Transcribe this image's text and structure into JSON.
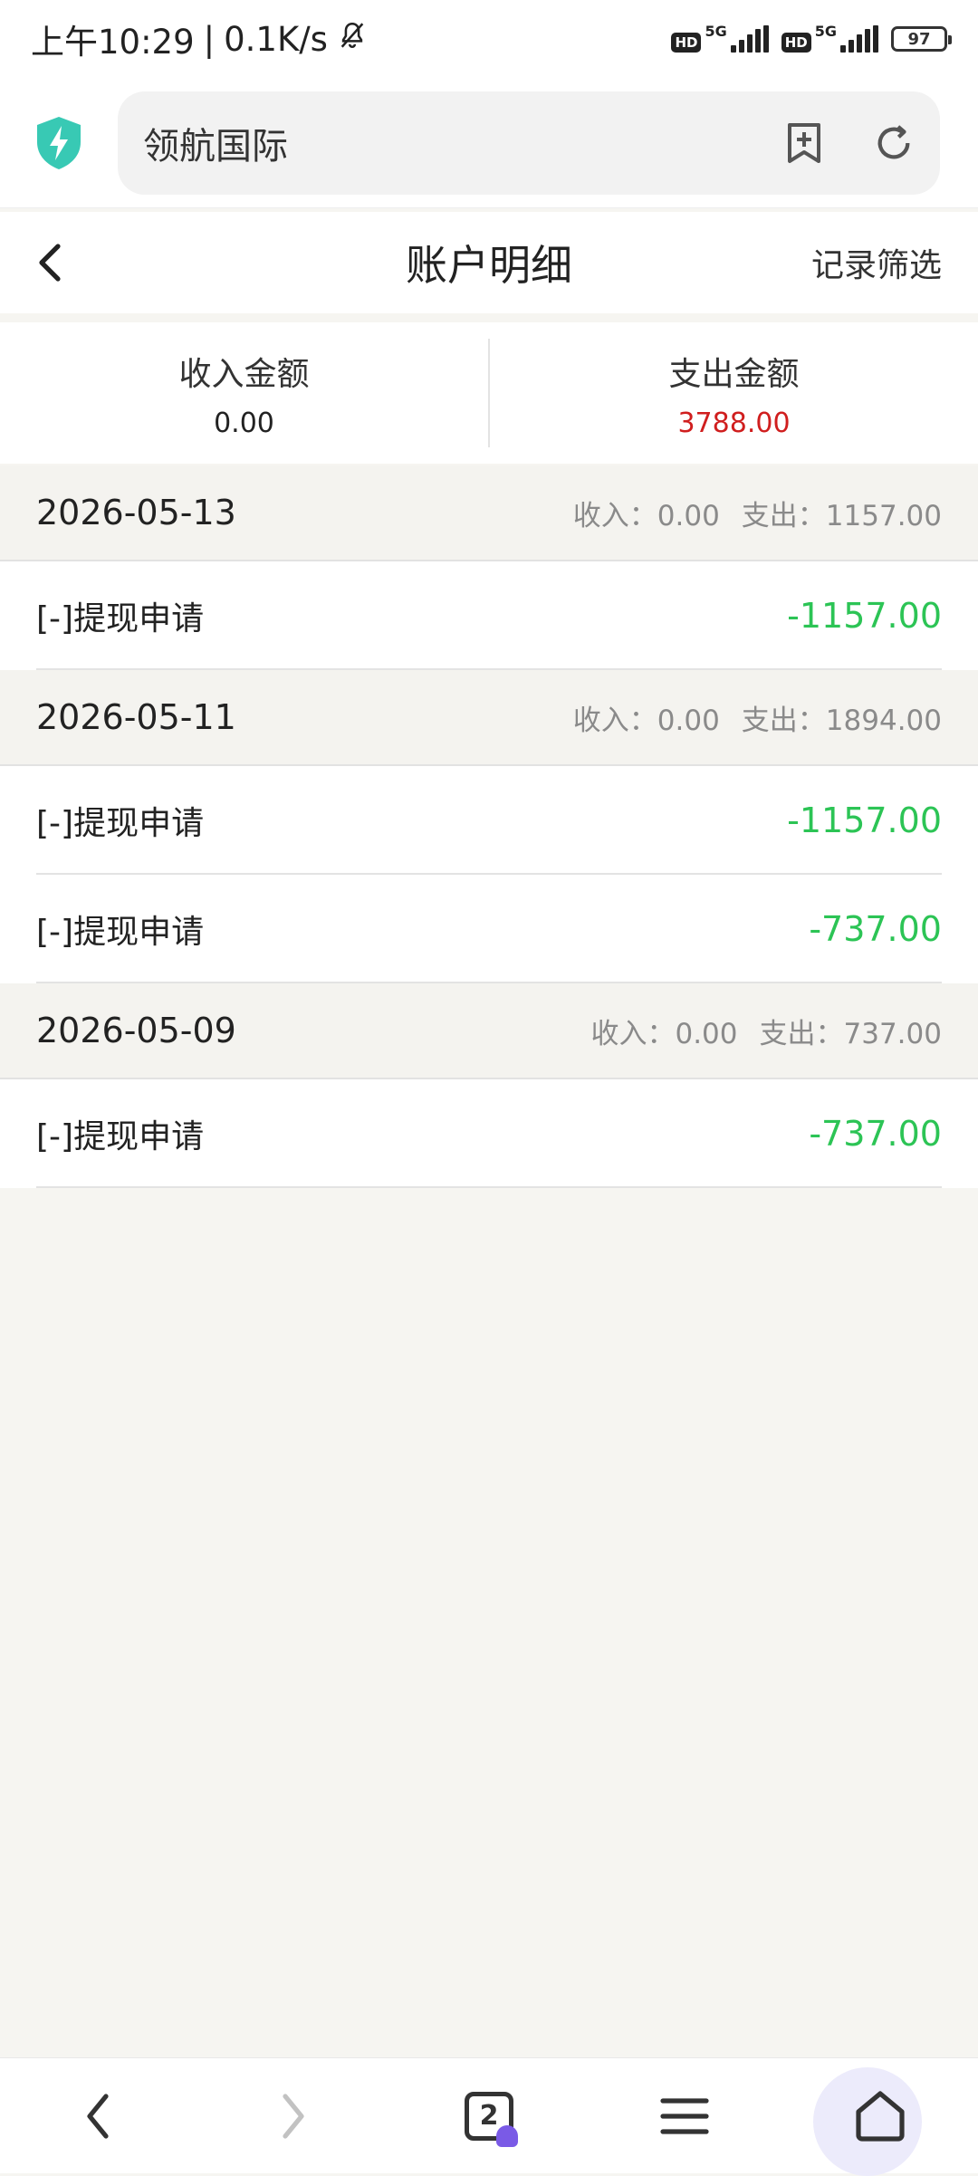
{
  "status_bar": {
    "time": "上午10:29",
    "separator": "|",
    "net_speed": "0.1K/s",
    "hd_label": "HD",
    "network_type": "5G",
    "battery": "97"
  },
  "browser": {
    "site_title": "领航国际",
    "icons": [
      "shield-bolt-icon",
      "bookmark-add-icon",
      "refresh-icon"
    ],
    "accent": "#38c9b4"
  },
  "header": {
    "title": "账户明细",
    "filter_label": "记录筛选"
  },
  "summary": {
    "income_label": "收入金额",
    "income_value": "0.00",
    "expense_label": "支出金额",
    "expense_value": "3788.00",
    "expense_color": "#d01e1e"
  },
  "groups": [
    {
      "date": "2026-05-13",
      "income": "收入：0.00",
      "expense": "支出：1157.00",
      "records": [
        {
          "title": "[-]提现申请",
          "amount": "-1157.00"
        }
      ]
    },
    {
      "date": "2026-05-11",
      "income": "收入：0.00",
      "expense": "支出：1894.00",
      "records": [
        {
          "title": "[-]提现申请",
          "amount": "-1157.00"
        },
        {
          "title": "[-]提现申请",
          "amount": "-737.00"
        }
      ]
    },
    {
      "date": "2026-05-09",
      "income": "收入：0.00",
      "expense": "支出：737.00",
      "records": [
        {
          "title": "[-]提现申请",
          "amount": "-737.00"
        }
      ]
    }
  ],
  "bottom_bar": {
    "tab_count": "2",
    "icons": [
      "back-icon",
      "forward-icon",
      "tabs-icon",
      "menu-icon",
      "home-icon"
    ],
    "amount_color": "#2cc455"
  }
}
